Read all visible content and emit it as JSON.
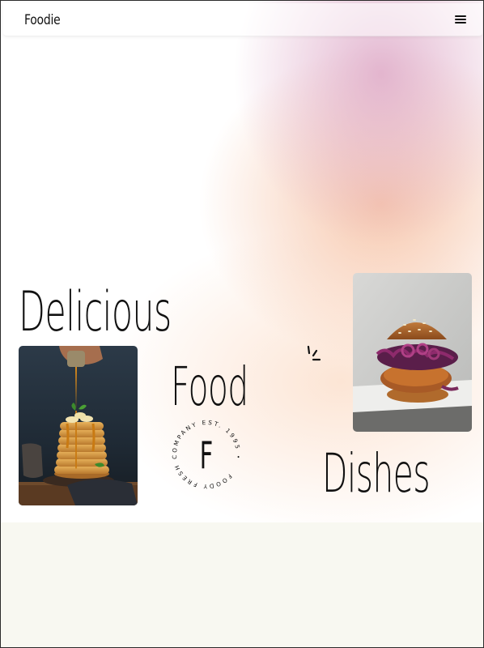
{
  "header": {
    "brand": "Foodie",
    "menu_icon": "hamburger-menu-icon"
  },
  "hero": {
    "words": [
      "Delicious",
      "Food",
      "Dishes"
    ],
    "badge": {
      "letter": "F",
      "ring_text": "FOODY FRESH COMPANY EST. 1995 •"
    },
    "images": [
      {
        "subject": "pancake stack with syrup",
        "icon": "pancake-photo"
      },
      {
        "subject": "burger with red cabbage",
        "icon": "burger-photo"
      }
    ]
  },
  "colors": {
    "text": "#111111",
    "gradient_pink": "#deaac8",
    "gradient_peach": "#f6c4a8",
    "lower_bg": "#f8f8f1"
  }
}
